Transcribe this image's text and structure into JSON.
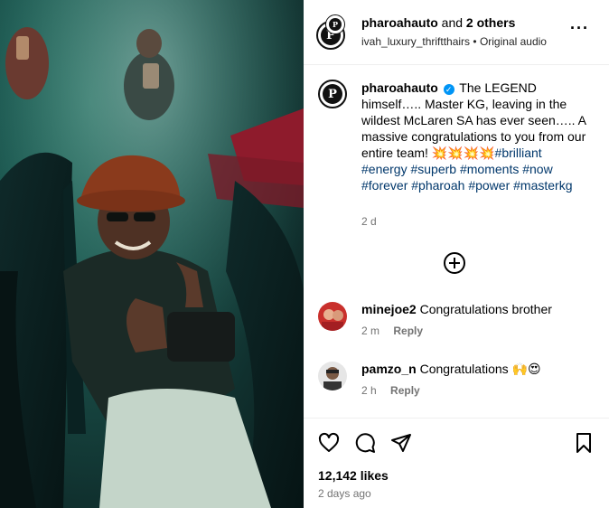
{
  "header": {
    "account": "pharoahauto",
    "and_text": " and ",
    "others": "2 others",
    "audio_user": "ivah_luxury_thriftthairs",
    "separator": " • ",
    "audio_label": "Original audio",
    "avatar_letter": "P"
  },
  "caption": {
    "user": "pharoahauto",
    "verified_mark": "✓",
    "text": " The LEGEND himself….. Master KG, leaving in the wildest McLaren SA has ever seen….. A massive congratulations to you from our entire team! 💥💥💥💥",
    "hashtags": [
      "#brilliant",
      "#energy",
      "#superb",
      "#moments",
      "#now",
      "#forever",
      "#pharoah",
      "#power",
      "#masterkg"
    ],
    "time": "2 d"
  },
  "comments": [
    {
      "user": "minejoe2",
      "text": "Congratulations brother",
      "time": "2 m",
      "reply": "Reply"
    },
    {
      "user": "pamzo_n",
      "text": "Congratulations 🙌😍",
      "time": "2 h",
      "reply": "Reply"
    }
  ],
  "footer": {
    "likes": "12,142 likes",
    "date": "2 days ago"
  },
  "icons": {
    "more": "more-options-icon",
    "add": "plus-circle-icon",
    "like": "heart-icon",
    "comment": "comment-icon",
    "share": "share-icon",
    "save": "bookmark-icon"
  },
  "colors": {
    "hashtag": "#00376b",
    "verified": "#0095f6",
    "muted": "#737373"
  }
}
